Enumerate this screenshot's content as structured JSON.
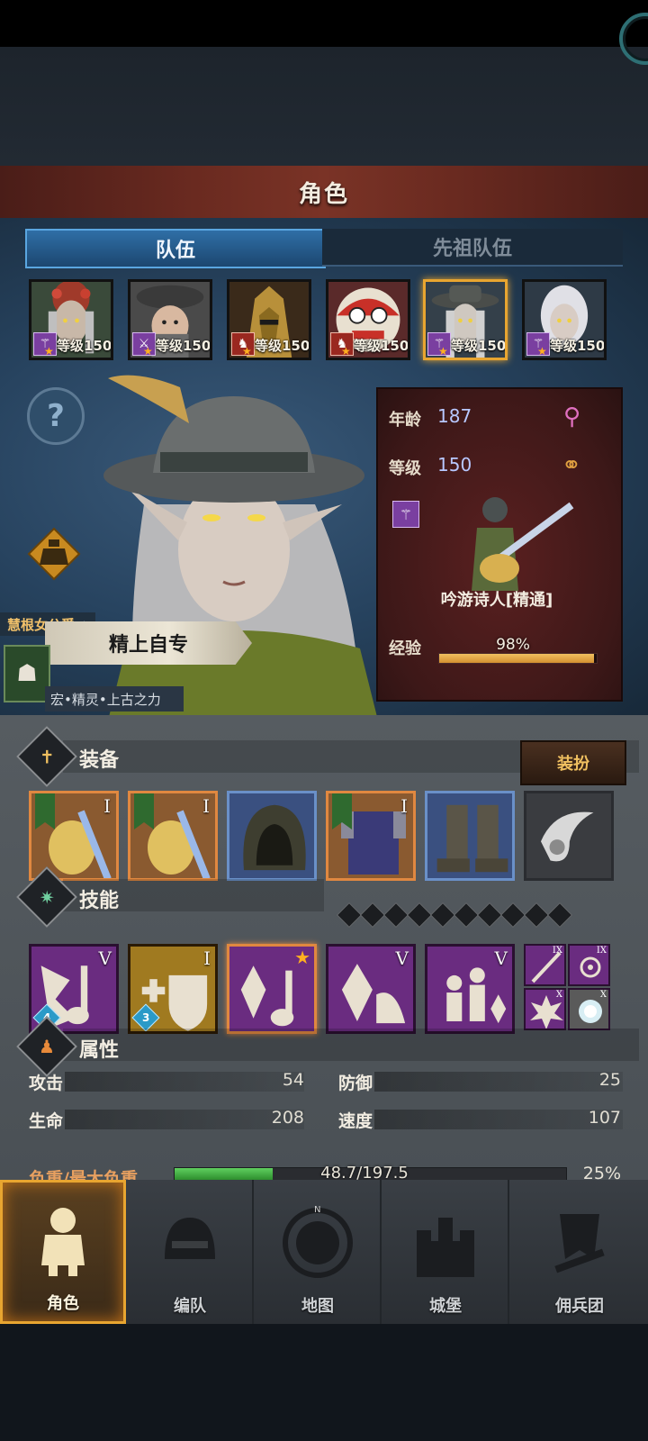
{
  "header": {
    "title": "角色"
  },
  "tabs": [
    {
      "label": "队伍",
      "active": true
    },
    {
      "label": "先祖队伍",
      "active": false
    }
  ],
  "roster": [
    {
      "level_text": "等级150",
      "class_icon": "staff-icon",
      "badge_color": "#7a3fa0",
      "selected": false
    },
    {
      "level_text": "等级150",
      "class_icon": "sword-icon",
      "badge_color": "#7a3fa0",
      "selected": false
    },
    {
      "level_text": "等级150",
      "class_icon": "horse-icon",
      "badge_color": "#9a2820",
      "selected": false
    },
    {
      "level_text": "等级150",
      "class_icon": "horse-icon",
      "badge_color": "#9a2820",
      "selected": false
    },
    {
      "level_text": "等级150",
      "class_icon": "staff-icon",
      "badge_color": "#7a3fa0",
      "selected": true
    },
    {
      "level_text": "等级150",
      "class_icon": "staff-icon",
      "badge_color": "#7a3fa0",
      "selected": false
    }
  ],
  "hero": {
    "title": "慧根女公爵",
    "name": "精上自专",
    "race": "宏•精灵•上古之力"
  },
  "info": {
    "age_label": "年龄",
    "age_value": "187",
    "level_label": "等级",
    "level_value": "150",
    "class_name": "吟游诗人[精通]",
    "exp_label": "经验",
    "exp_text": "98%",
    "exp_fraction": 0.98
  },
  "equipment": {
    "title": "装备",
    "dress_button": "装扮",
    "slots": [
      {
        "tier": "I",
        "rarity": "orange",
        "icon": "lute-icon"
      },
      {
        "tier": "I",
        "rarity": "orange",
        "icon": "lute-icon"
      },
      {
        "tier": "",
        "rarity": "blue",
        "icon": "hood-icon"
      },
      {
        "tier": "I",
        "rarity": "orange",
        "icon": "armor-icon"
      },
      {
        "tier": "",
        "rarity": "blue",
        "icon": "boots-icon"
      },
      {
        "tier": "",
        "rarity": "gray",
        "icon": "horn-icon"
      }
    ]
  },
  "skills": {
    "title": "技能",
    "slots": [
      {
        "tier": "V",
        "level": "4",
        "color": "purple",
        "icon": "music-note-icon"
      },
      {
        "tier": "I",
        "level": "3",
        "color": "gold",
        "icon": "shield-heal-icon"
      },
      {
        "tier": "",
        "level": "",
        "color": "purple",
        "icon": "crystal-note-icon",
        "starred": true
      },
      {
        "tier": "V",
        "level": "",
        "color": "purple",
        "icon": "crystal-icon"
      },
      {
        "tier": "V",
        "level": "",
        "color": "purple",
        "icon": "party-icon"
      }
    ],
    "mini": [
      {
        "tier": "IX",
        "icon": "wand-icon",
        "color": "purple"
      },
      {
        "tier": "IX",
        "icon": "target-icon",
        "color": "purple"
      },
      {
        "tier": "X",
        "icon": "burst-icon",
        "color": "purple"
      },
      {
        "tier": "X",
        "icon": "flash-icon",
        "color": "gray"
      }
    ]
  },
  "attributes": {
    "title": "属性",
    "attack_label": "攻击",
    "attack_value": "54",
    "defense_label": "防御",
    "defense_value": "25",
    "hp_label": "生命",
    "hp_value": "208",
    "speed_label": "速度",
    "speed_value": "107",
    "load_label": "负重/最大负重",
    "load_text": "48.7/197.5",
    "load_percent": "25%",
    "load_fraction": 0.25
  },
  "nav": [
    {
      "label": "角色",
      "icon": "knight-icon",
      "active": true
    },
    {
      "label": "编队",
      "icon": "helmet-icon",
      "active": false
    },
    {
      "label": "地图",
      "icon": "compass-map-icon",
      "active": false
    },
    {
      "label": "城堡",
      "icon": "castle-icon",
      "active": false
    },
    {
      "label": "佣兵团",
      "icon": "banner-icon",
      "active": false
    }
  ]
}
